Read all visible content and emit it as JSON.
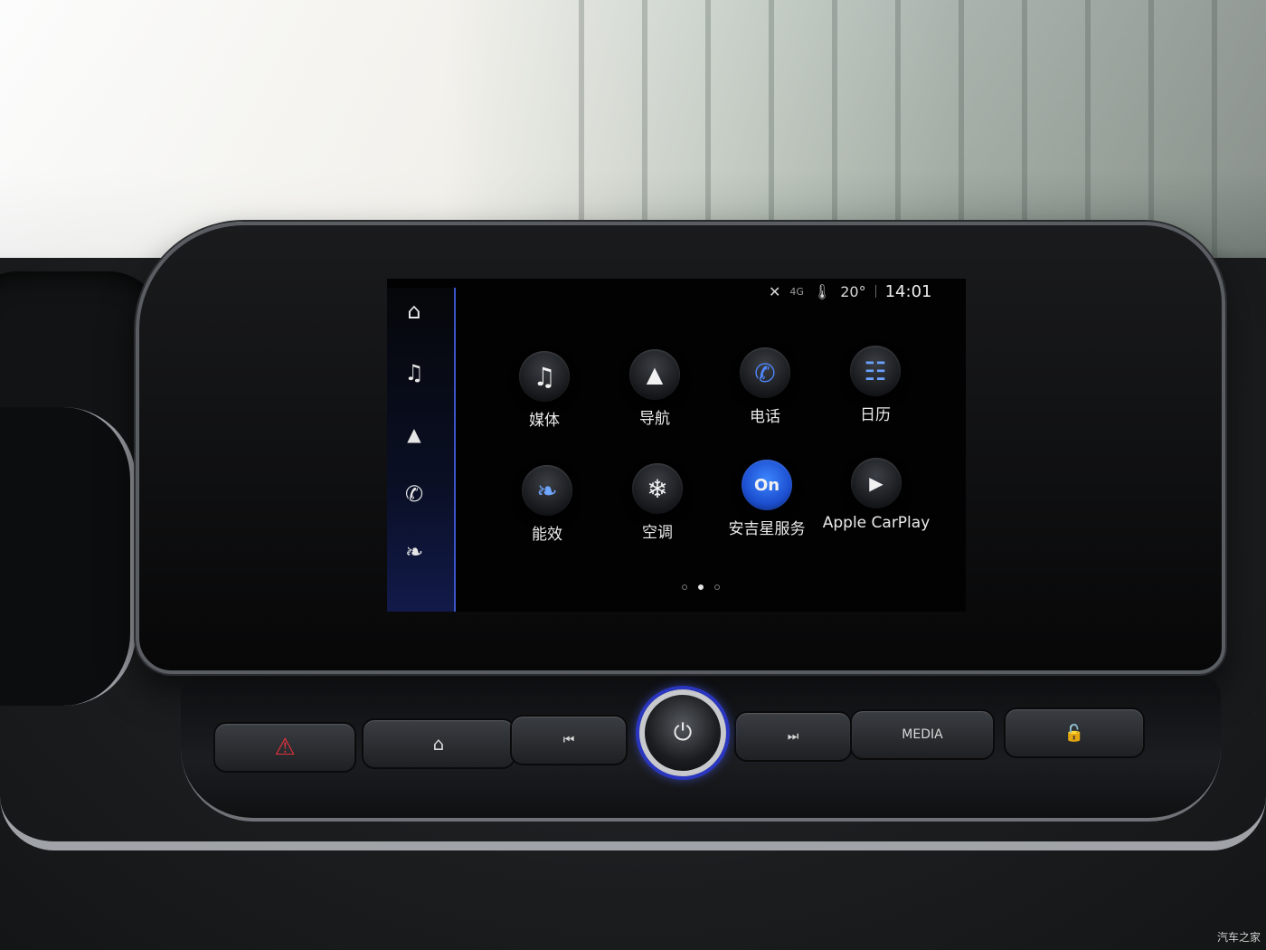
{
  "status": {
    "temperature": "20°",
    "time": "14:01",
    "network": "4G"
  },
  "sidebar": {
    "items": [
      {
        "icon": "home-icon",
        "glyph": "⌂"
      },
      {
        "icon": "music-note-icon",
        "glyph": "♫"
      },
      {
        "icon": "navigation-arrow-icon",
        "glyph": "▲"
      },
      {
        "icon": "phone-icon",
        "glyph": "✆"
      },
      {
        "icon": "leaf-icon",
        "glyph": "❧"
      }
    ]
  },
  "apps": [
    {
      "label": "媒体",
      "icon": "music-note-icon",
      "glyph": "♫"
    },
    {
      "label": "导航",
      "icon": "navigation-arrow-icon",
      "glyph": "▲"
    },
    {
      "label": "电话",
      "icon": "phone-icon",
      "glyph": "✆"
    },
    {
      "label": "日历",
      "icon": "calendar-icon",
      "glyph": "☷"
    },
    {
      "label": "能效",
      "icon": "leaf-icon",
      "glyph": "❧"
    },
    {
      "label": "空调",
      "icon": "snowflake-icon",
      "glyph": "❄"
    },
    {
      "label": "安吉星服务",
      "icon": "onstar-icon",
      "glyph": "On"
    },
    {
      "label": "Apple CarPlay",
      "icon": "carplay-icon",
      "glyph": "▶"
    }
  ],
  "page_indicator": {
    "current_page": 2,
    "total_pages": 3
  },
  "hardware_buttons": {
    "media_label": "MEDIA",
    "hazard_icon": "hazard-icon",
    "home_icon": "home-icon",
    "prev_icon": "previous-track-icon",
    "next_icon": "next-track-icon",
    "lock_icon": "lock-icon",
    "power_icon": "power-icon"
  },
  "watermark": "汽车之家"
}
